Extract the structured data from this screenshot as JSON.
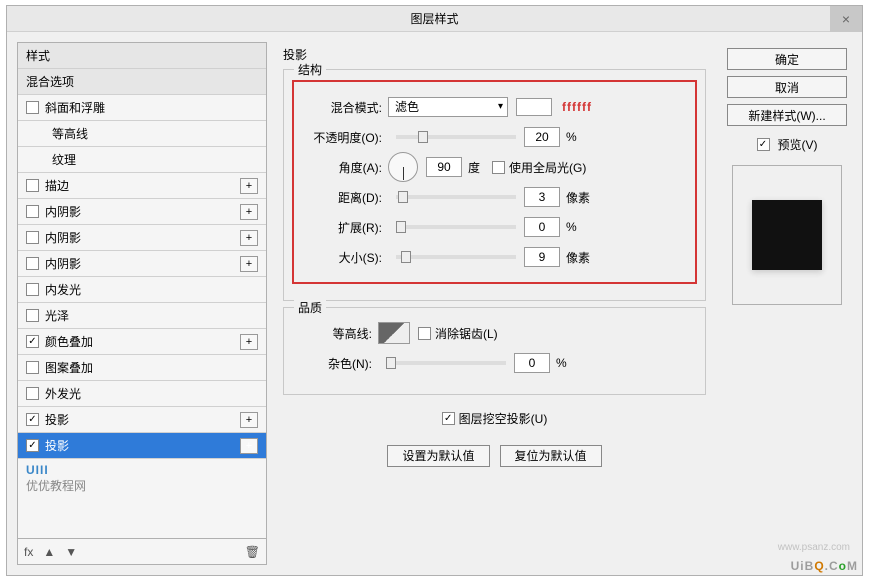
{
  "dialog": {
    "title": "图层样式",
    "close": "×"
  },
  "left": {
    "header1": "样式",
    "header2": "混合选项",
    "items": [
      {
        "label": "斜面和浮雕",
        "checked": false,
        "plus": false,
        "indent": false
      },
      {
        "label": "等高线",
        "checked": false,
        "plus": false,
        "indent": true
      },
      {
        "label": "纹理",
        "checked": false,
        "plus": false,
        "indent": true
      },
      {
        "label": "描边",
        "checked": false,
        "plus": true,
        "indent": false
      },
      {
        "label": "内阴影",
        "checked": false,
        "plus": true,
        "indent": false
      },
      {
        "label": "内阴影",
        "checked": false,
        "plus": true,
        "indent": false
      },
      {
        "label": "内阴影",
        "checked": false,
        "plus": true,
        "indent": false
      },
      {
        "label": "内发光",
        "checked": false,
        "plus": false,
        "indent": false
      },
      {
        "label": "光泽",
        "checked": false,
        "plus": false,
        "indent": false
      },
      {
        "label": "颜色叠加",
        "checked": true,
        "plus": true,
        "indent": false
      },
      {
        "label": "图案叠加",
        "checked": false,
        "plus": false,
        "indent": false
      },
      {
        "label": "外发光",
        "checked": false,
        "plus": false,
        "indent": false
      },
      {
        "label": "投影",
        "checked": true,
        "plus": true,
        "indent": false
      },
      {
        "label": "投影",
        "checked": true,
        "plus": true,
        "indent": false,
        "selected": true
      }
    ],
    "footer": {
      "fx": "fx",
      "up": "▲",
      "down": "▼",
      "trash": "🗑"
    },
    "wm": {
      "logo": "UIII",
      "text": "优优教程网"
    }
  },
  "mid": {
    "title": "投影",
    "structure": {
      "label": "结构",
      "blend_mode_label": "混合模式:",
      "blend_mode": "滤色",
      "hex": "ffffff",
      "opacity_label": "不透明度(O):",
      "opacity": "20",
      "opacity_unit": "%",
      "angle_label": "角度(A):",
      "angle": "90",
      "angle_unit": "度",
      "global_light_label": "使用全局光(G)",
      "global_light_checked": false,
      "distance_label": "距离(D):",
      "distance": "3",
      "distance_unit": "像素",
      "spread_label": "扩展(R):",
      "spread": "0",
      "spread_unit": "%",
      "size_label": "大小(S):",
      "size": "9",
      "size_unit": "像素"
    },
    "quality": {
      "label": "品质",
      "contour_label": "等高线:",
      "antialias_label": "消除锯齿(L)",
      "antialias_checked": false,
      "noise_label": "杂色(N):",
      "noise": "0",
      "noise_unit": "%"
    },
    "knockout_label": "图层挖空投影(U)",
    "knockout_checked": true,
    "default_btn": "设置为默认值",
    "reset_btn": "复位为默认值"
  },
  "right": {
    "ok": "确定",
    "cancel": "取消",
    "new_style": "新建样式(W)...",
    "preview_label": "预览(V)",
    "preview_checked": true
  },
  "wm": {
    "text": "UiBQ.CoM",
    "psanz": "www.psanz.com"
  }
}
